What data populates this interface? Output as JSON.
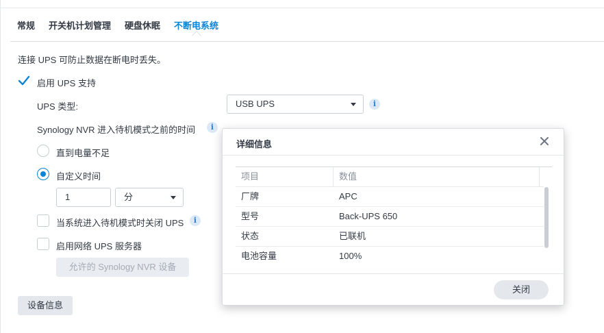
{
  "tabs": [
    {
      "label": "常规"
    },
    {
      "label": "开关机计划管理"
    },
    {
      "label": "硬盘休眠"
    },
    {
      "label": "不断电系统"
    }
  ],
  "description": "连接 UPS 可防止数据在断电时丢失。",
  "enable_ups": {
    "label": "启用 UPS 支持",
    "checked": true
  },
  "ups_type": {
    "label": "UPS 类型:",
    "value": "USB UPS"
  },
  "standby_time": {
    "label": "Synology NVR 进入待机模式之前的时间"
  },
  "radio_low_battery": {
    "label": "直到电量不足",
    "selected": false
  },
  "radio_custom": {
    "label": "自定义时间",
    "selected": true
  },
  "custom_time": {
    "value": "1",
    "unit": "分"
  },
  "shutdown_ups": {
    "label": "当系统进入待机模式时关闭 UPS",
    "checked": false
  },
  "network_ups": {
    "label": "启用网络 UPS 服务器",
    "checked": false
  },
  "allow_devices_button": {
    "label": "允许的 Synology NVR 设备"
  },
  "device_info_button": {
    "label": "设备信息"
  },
  "dialog": {
    "title": "详细信息",
    "columns": [
      "项目",
      "数值"
    ],
    "rows": [
      {
        "item": "厂牌",
        "value": "APC"
      },
      {
        "item": "型号",
        "value": "Back-UPS 650"
      },
      {
        "item": "状态",
        "value": "已联机"
      },
      {
        "item": "电池容量",
        "value": "100%"
      }
    ],
    "close_label": "关闭"
  },
  "colors": {
    "accent": "#0a84d6",
    "text": "#333a44"
  }
}
